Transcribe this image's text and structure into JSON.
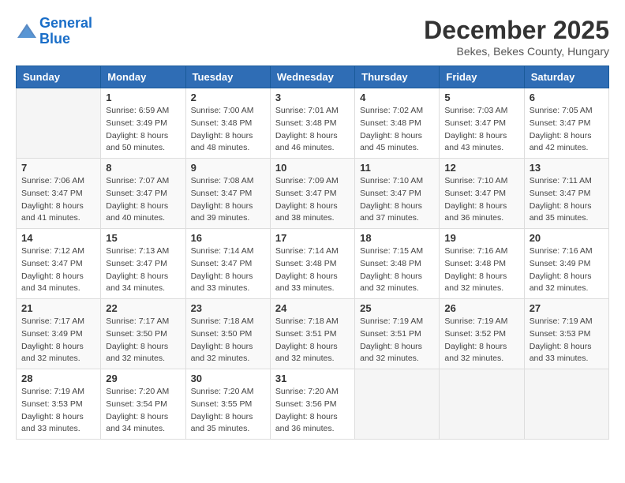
{
  "header": {
    "logo_line1": "General",
    "logo_line2": "Blue",
    "month": "December 2025",
    "location": "Bekes, Bekes County, Hungary"
  },
  "weekdays": [
    "Sunday",
    "Monday",
    "Tuesday",
    "Wednesday",
    "Thursday",
    "Friday",
    "Saturday"
  ],
  "weeks": [
    [
      {
        "day": "",
        "sunrise": "",
        "sunset": "",
        "daylight": ""
      },
      {
        "day": "1",
        "sunrise": "Sunrise: 6:59 AM",
        "sunset": "Sunset: 3:49 PM",
        "daylight": "Daylight: 8 hours and 50 minutes."
      },
      {
        "day": "2",
        "sunrise": "Sunrise: 7:00 AM",
        "sunset": "Sunset: 3:48 PM",
        "daylight": "Daylight: 8 hours and 48 minutes."
      },
      {
        "day": "3",
        "sunrise": "Sunrise: 7:01 AM",
        "sunset": "Sunset: 3:48 PM",
        "daylight": "Daylight: 8 hours and 46 minutes."
      },
      {
        "day": "4",
        "sunrise": "Sunrise: 7:02 AM",
        "sunset": "Sunset: 3:48 PM",
        "daylight": "Daylight: 8 hours and 45 minutes."
      },
      {
        "day": "5",
        "sunrise": "Sunrise: 7:03 AM",
        "sunset": "Sunset: 3:47 PM",
        "daylight": "Daylight: 8 hours and 43 minutes."
      },
      {
        "day": "6",
        "sunrise": "Sunrise: 7:05 AM",
        "sunset": "Sunset: 3:47 PM",
        "daylight": "Daylight: 8 hours and 42 minutes."
      }
    ],
    [
      {
        "day": "7",
        "sunrise": "Sunrise: 7:06 AM",
        "sunset": "Sunset: 3:47 PM",
        "daylight": "Daylight: 8 hours and 41 minutes."
      },
      {
        "day": "8",
        "sunrise": "Sunrise: 7:07 AM",
        "sunset": "Sunset: 3:47 PM",
        "daylight": "Daylight: 8 hours and 40 minutes."
      },
      {
        "day": "9",
        "sunrise": "Sunrise: 7:08 AM",
        "sunset": "Sunset: 3:47 PM",
        "daylight": "Daylight: 8 hours and 39 minutes."
      },
      {
        "day": "10",
        "sunrise": "Sunrise: 7:09 AM",
        "sunset": "Sunset: 3:47 PM",
        "daylight": "Daylight: 8 hours and 38 minutes."
      },
      {
        "day": "11",
        "sunrise": "Sunrise: 7:10 AM",
        "sunset": "Sunset: 3:47 PM",
        "daylight": "Daylight: 8 hours and 37 minutes."
      },
      {
        "day": "12",
        "sunrise": "Sunrise: 7:10 AM",
        "sunset": "Sunset: 3:47 PM",
        "daylight": "Daylight: 8 hours and 36 minutes."
      },
      {
        "day": "13",
        "sunrise": "Sunrise: 7:11 AM",
        "sunset": "Sunset: 3:47 PM",
        "daylight": "Daylight: 8 hours and 35 minutes."
      }
    ],
    [
      {
        "day": "14",
        "sunrise": "Sunrise: 7:12 AM",
        "sunset": "Sunset: 3:47 PM",
        "daylight": "Daylight: 8 hours and 34 minutes."
      },
      {
        "day": "15",
        "sunrise": "Sunrise: 7:13 AM",
        "sunset": "Sunset: 3:47 PM",
        "daylight": "Daylight: 8 hours and 34 minutes."
      },
      {
        "day": "16",
        "sunrise": "Sunrise: 7:14 AM",
        "sunset": "Sunset: 3:47 PM",
        "daylight": "Daylight: 8 hours and 33 minutes."
      },
      {
        "day": "17",
        "sunrise": "Sunrise: 7:14 AM",
        "sunset": "Sunset: 3:48 PM",
        "daylight": "Daylight: 8 hours and 33 minutes."
      },
      {
        "day": "18",
        "sunrise": "Sunrise: 7:15 AM",
        "sunset": "Sunset: 3:48 PM",
        "daylight": "Daylight: 8 hours and 32 minutes."
      },
      {
        "day": "19",
        "sunrise": "Sunrise: 7:16 AM",
        "sunset": "Sunset: 3:48 PM",
        "daylight": "Daylight: 8 hours and 32 minutes."
      },
      {
        "day": "20",
        "sunrise": "Sunrise: 7:16 AM",
        "sunset": "Sunset: 3:49 PM",
        "daylight": "Daylight: 8 hours and 32 minutes."
      }
    ],
    [
      {
        "day": "21",
        "sunrise": "Sunrise: 7:17 AM",
        "sunset": "Sunset: 3:49 PM",
        "daylight": "Daylight: 8 hours and 32 minutes."
      },
      {
        "day": "22",
        "sunrise": "Sunrise: 7:17 AM",
        "sunset": "Sunset: 3:50 PM",
        "daylight": "Daylight: 8 hours and 32 minutes."
      },
      {
        "day": "23",
        "sunrise": "Sunrise: 7:18 AM",
        "sunset": "Sunset: 3:50 PM",
        "daylight": "Daylight: 8 hours and 32 minutes."
      },
      {
        "day": "24",
        "sunrise": "Sunrise: 7:18 AM",
        "sunset": "Sunset: 3:51 PM",
        "daylight": "Daylight: 8 hours and 32 minutes."
      },
      {
        "day": "25",
        "sunrise": "Sunrise: 7:19 AM",
        "sunset": "Sunset: 3:51 PM",
        "daylight": "Daylight: 8 hours and 32 minutes."
      },
      {
        "day": "26",
        "sunrise": "Sunrise: 7:19 AM",
        "sunset": "Sunset: 3:52 PM",
        "daylight": "Daylight: 8 hours and 32 minutes."
      },
      {
        "day": "27",
        "sunrise": "Sunrise: 7:19 AM",
        "sunset": "Sunset: 3:53 PM",
        "daylight": "Daylight: 8 hours and 33 minutes."
      }
    ],
    [
      {
        "day": "28",
        "sunrise": "Sunrise: 7:19 AM",
        "sunset": "Sunset: 3:53 PM",
        "daylight": "Daylight: 8 hours and 33 minutes."
      },
      {
        "day": "29",
        "sunrise": "Sunrise: 7:20 AM",
        "sunset": "Sunset: 3:54 PM",
        "daylight": "Daylight: 8 hours and 34 minutes."
      },
      {
        "day": "30",
        "sunrise": "Sunrise: 7:20 AM",
        "sunset": "Sunset: 3:55 PM",
        "daylight": "Daylight: 8 hours and 35 minutes."
      },
      {
        "day": "31",
        "sunrise": "Sunrise: 7:20 AM",
        "sunset": "Sunset: 3:56 PM",
        "daylight": "Daylight: 8 hours and 36 minutes."
      },
      {
        "day": "",
        "sunrise": "",
        "sunset": "",
        "daylight": ""
      },
      {
        "day": "",
        "sunrise": "",
        "sunset": "",
        "daylight": ""
      },
      {
        "day": "",
        "sunrise": "",
        "sunset": "",
        "daylight": ""
      }
    ]
  ]
}
